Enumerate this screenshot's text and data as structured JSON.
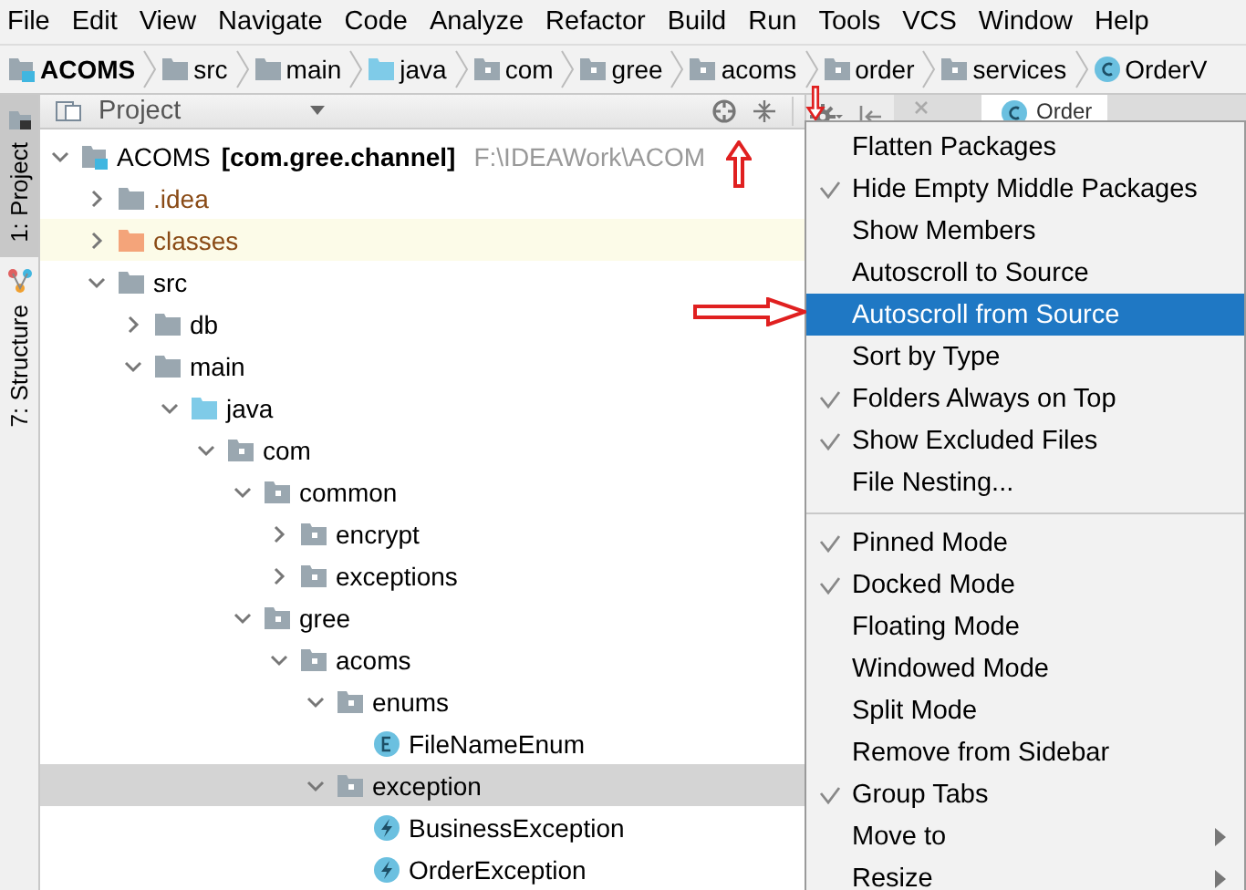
{
  "menu_bar": [
    {
      "label": "File"
    },
    {
      "label": "Edit"
    },
    {
      "label": "View"
    },
    {
      "label": "Navigate"
    },
    {
      "label": "Code"
    },
    {
      "label": "Analyze"
    },
    {
      "label": "Refactor"
    },
    {
      "label": "Build"
    },
    {
      "label": "Run"
    },
    {
      "label": "Tools"
    },
    {
      "label": "VCS"
    },
    {
      "label": "Window"
    },
    {
      "label": "Help"
    }
  ],
  "breadcrumb": [
    {
      "label": "ACOMS",
      "kind": "project"
    },
    {
      "label": "src",
      "kind": "folder"
    },
    {
      "label": "main",
      "kind": "folder"
    },
    {
      "label": "java",
      "kind": "source"
    },
    {
      "label": "com",
      "kind": "package"
    },
    {
      "label": "gree",
      "kind": "package"
    },
    {
      "label": "acoms",
      "kind": "package"
    },
    {
      "label": "order",
      "kind": "package"
    },
    {
      "label": "services",
      "kind": "package"
    },
    {
      "label": "OrderV",
      "kind": "class"
    }
  ],
  "tool_window_bar": [
    {
      "label": "1: Project",
      "selected": true,
      "kind": "project"
    },
    {
      "label": "7: Structure",
      "selected": false,
      "kind": "structure"
    }
  ],
  "project_panel": {
    "title": "Project",
    "tree": [
      {
        "label": "ACOMS",
        "module": "[com.gree.channel]",
        "path": "F:\\IDEAWork\\ACOM",
        "kind": "project",
        "expanded": true,
        "selected": false,
        "children": [
          {
            "label": ".idea",
            "kind": "hidden_folder",
            "expanded": false,
            "selected": false
          },
          {
            "label": "classes",
            "kind": "excluded_folder",
            "expanded": false,
            "selected": false
          },
          {
            "label": "src",
            "kind": "folder",
            "expanded": true,
            "selected": false,
            "children": [
              {
                "label": "db",
                "kind": "folder",
                "expanded": false,
                "selected": false
              },
              {
                "label": "main",
                "kind": "folder",
                "expanded": true,
                "selected": false,
                "children": [
                  {
                    "label": "java",
                    "kind": "source",
                    "expanded": true,
                    "selected": false,
                    "children": [
                      {
                        "label": "com",
                        "kind": "package",
                        "expanded": true,
                        "selected": false,
                        "children": [
                          {
                            "label": "common",
                            "kind": "package",
                            "expanded": true,
                            "selected": false,
                            "children": [
                              {
                                "label": "encrypt",
                                "kind": "package",
                                "expanded": false,
                                "selected": false
                              },
                              {
                                "label": "exceptions",
                                "kind": "package",
                                "expanded": false,
                                "selected": false
                              }
                            ]
                          },
                          {
                            "label": "gree",
                            "kind": "package",
                            "expanded": true,
                            "selected": false,
                            "children": [
                              {
                                "label": "acoms",
                                "kind": "package",
                                "expanded": true,
                                "selected": false,
                                "children": [
                                  {
                                    "label": "enums",
                                    "kind": "package",
                                    "expanded": true,
                                    "selected": false,
                                    "children": [
                                      {
                                        "label": "FileNameEnum",
                                        "kind": "enum",
                                        "selected": false
                                      }
                                    ]
                                  },
                                  {
                                    "label": "exception",
                                    "kind": "package",
                                    "expanded": true,
                                    "selected": true,
                                    "children": [
                                      {
                                        "label": "BusinessException",
                                        "kind": "exception",
                                        "selected": false
                                      },
                                      {
                                        "label": "OrderException",
                                        "kind": "exception",
                                        "selected": false
                                      }
                                    ]
                                  }
                                ]
                              }
                            ]
                          }
                        ]
                      }
                    ]
                  }
                ]
              }
            ]
          }
        ]
      }
    ]
  },
  "editor_tabs": [
    {
      "selected": false,
      "kind": "file"
    },
    {
      "label": "Order",
      "selected": true,
      "kind": "class"
    }
  ],
  "popup_menu": [
    {
      "kind": "item",
      "label": "Flatten Packages",
      "checked": false,
      "selected": false
    },
    {
      "kind": "item",
      "label": "Hide Empty Middle Packages",
      "checked": true,
      "selected": false
    },
    {
      "kind": "item",
      "label": "Show Members",
      "checked": false,
      "selected": false
    },
    {
      "kind": "item",
      "label": "Autoscroll to Source",
      "checked": false,
      "selected": false
    },
    {
      "kind": "item",
      "label": "Autoscroll from Source",
      "checked": false,
      "selected": true
    },
    {
      "kind": "item",
      "label": "Sort by Type",
      "checked": false,
      "selected": false
    },
    {
      "kind": "item",
      "label": "Folders Always on Top",
      "checked": true,
      "selected": false
    },
    {
      "kind": "item",
      "label": "Show Excluded Files",
      "checked": true,
      "selected": false
    },
    {
      "kind": "item",
      "label": "File Nesting...",
      "checked": false,
      "selected": false
    },
    {
      "kind": "separator"
    },
    {
      "kind": "item",
      "label": "Pinned Mode",
      "checked": true,
      "selected": false
    },
    {
      "kind": "item",
      "label": "Docked Mode",
      "checked": true,
      "selected": false
    },
    {
      "kind": "item",
      "label": "Floating Mode",
      "checked": false,
      "selected": false
    },
    {
      "kind": "item",
      "label": "Windowed Mode",
      "checked": false,
      "selected": false
    },
    {
      "kind": "item",
      "label": "Split Mode",
      "checked": false,
      "selected": false
    },
    {
      "kind": "item",
      "label": "Remove from Sidebar",
      "checked": false,
      "selected": false
    },
    {
      "kind": "item",
      "label": "Group Tabs",
      "checked": true,
      "selected": false
    },
    {
      "kind": "submenu",
      "label": "Move to",
      "checked": false,
      "selected": false
    },
    {
      "kind": "submenu",
      "label": "Resize",
      "checked": false,
      "selected": false
    }
  ]
}
